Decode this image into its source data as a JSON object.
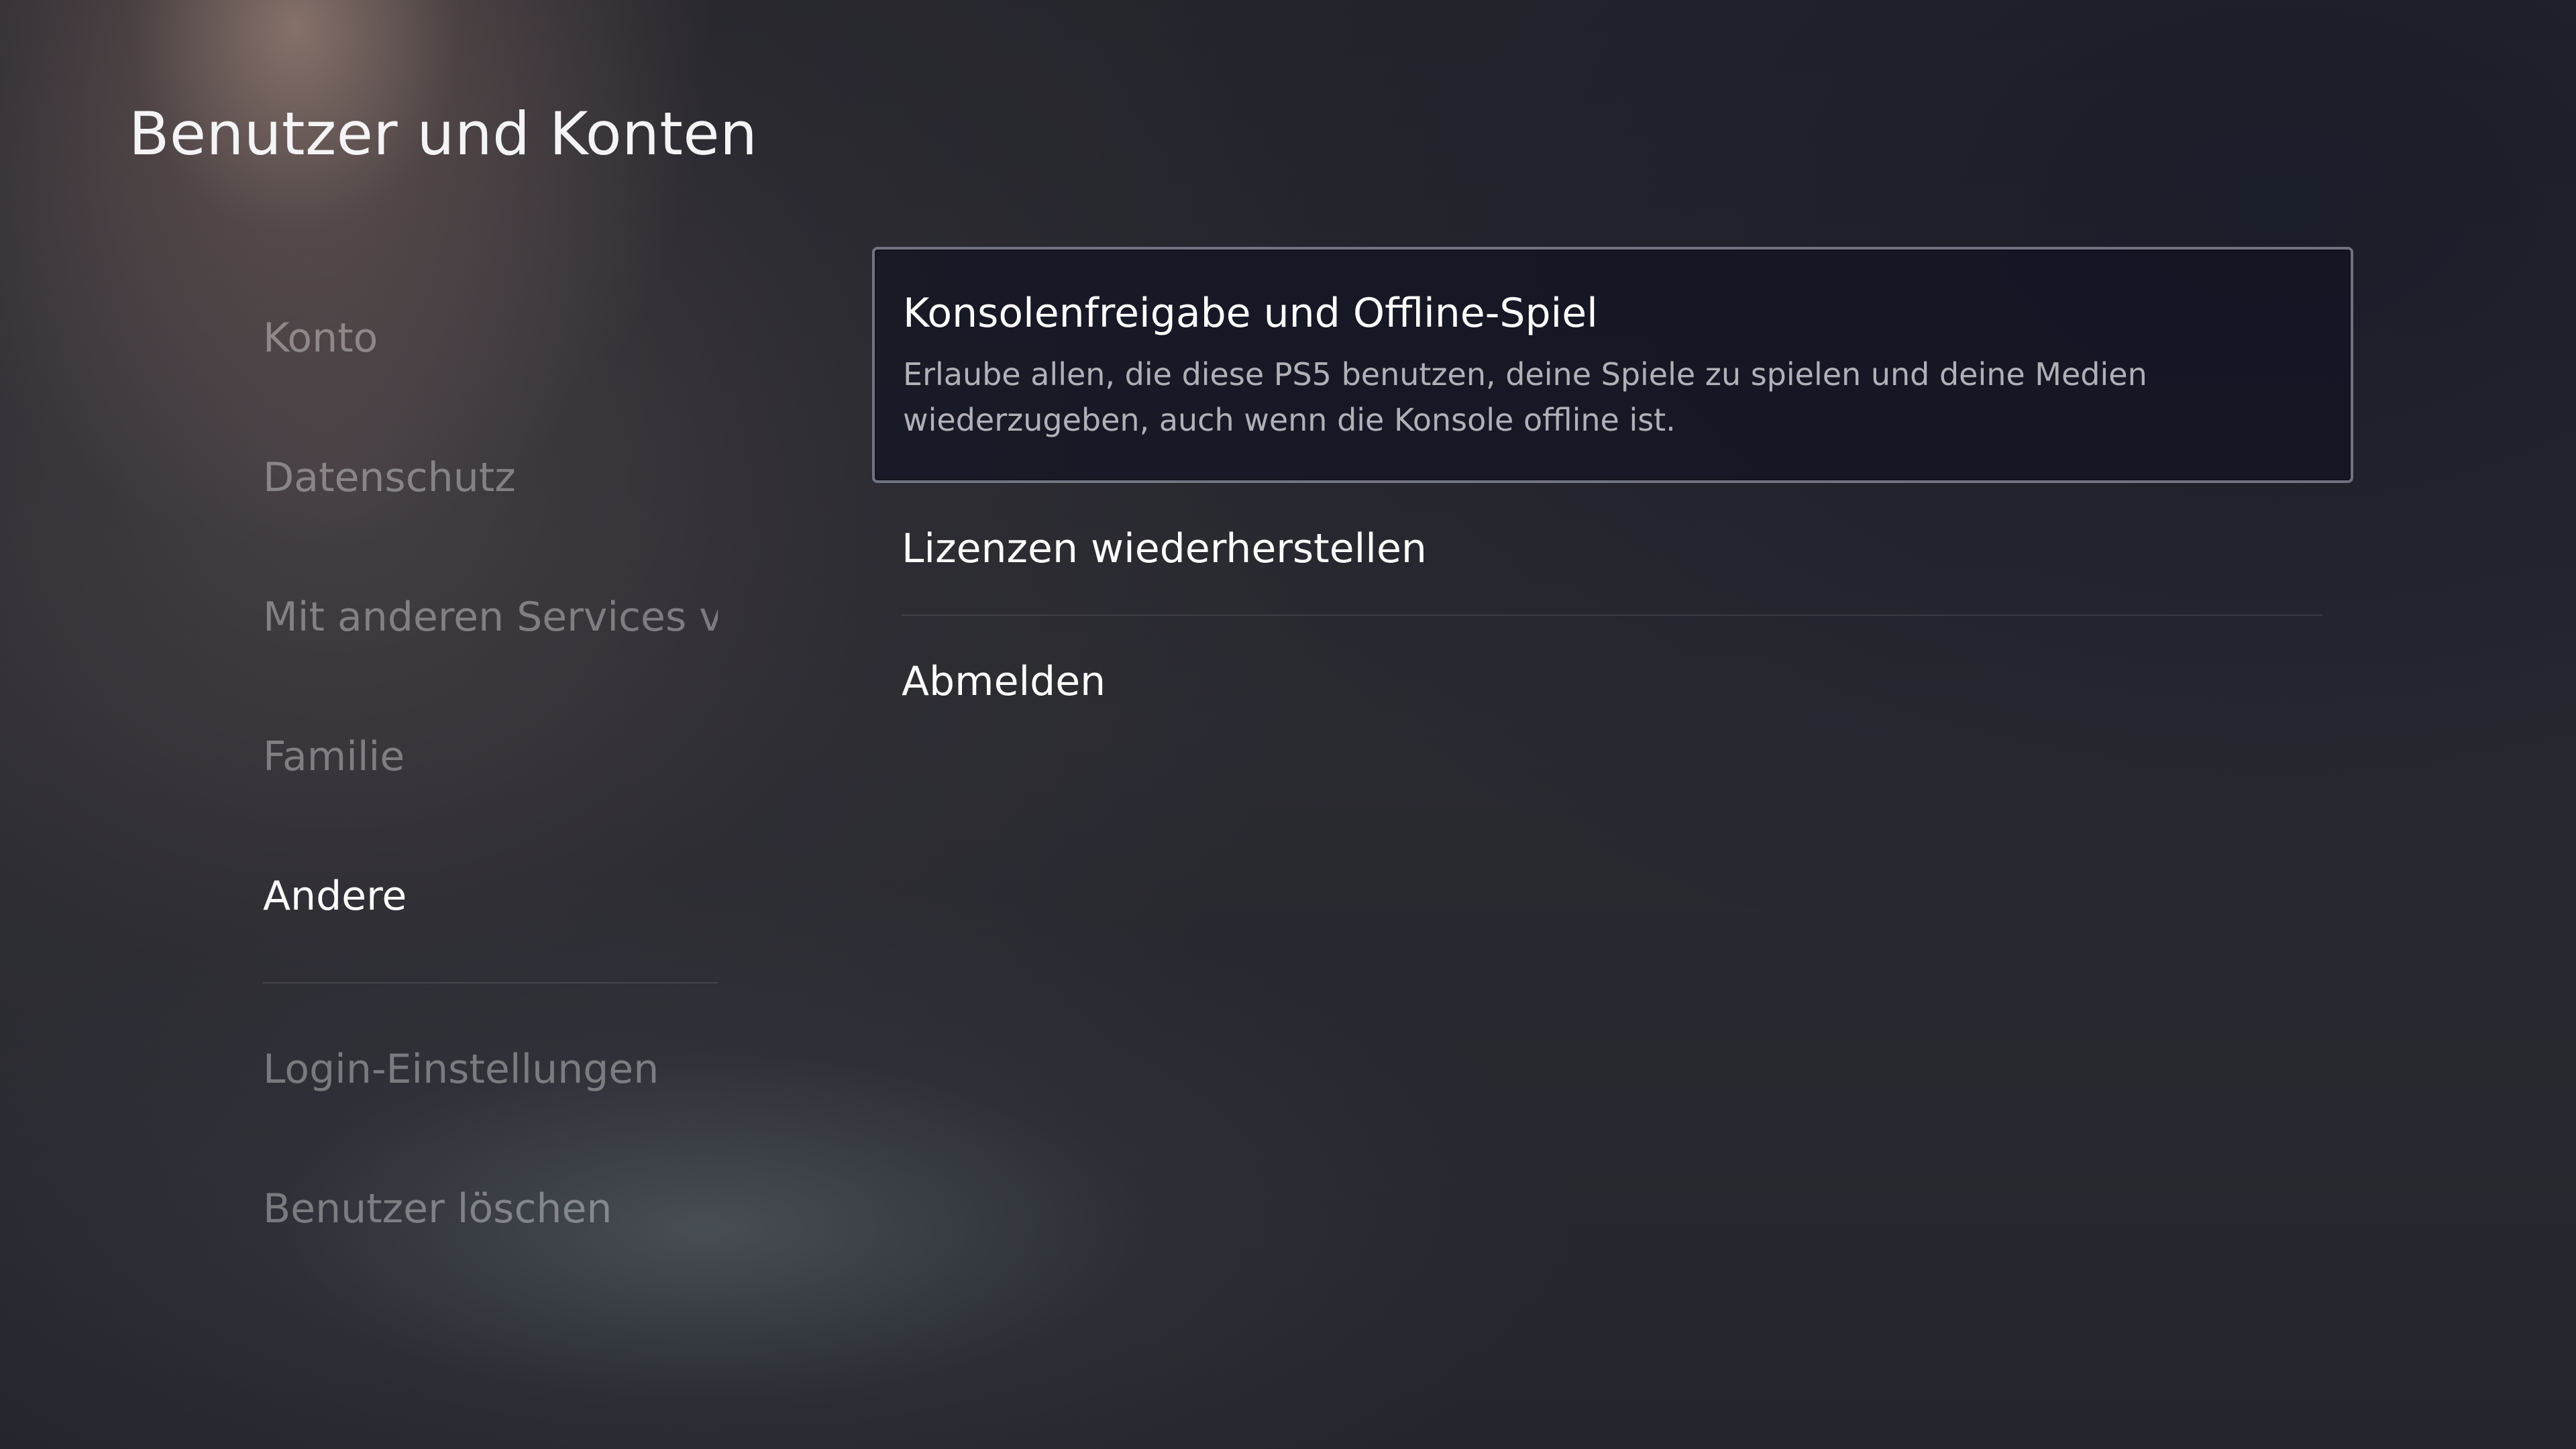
{
  "header": {
    "title": "Benutzer und Konten"
  },
  "sidebar": {
    "items": [
      {
        "label": "Konto"
      },
      {
        "label": "Datenschutz"
      },
      {
        "label": "Mit anderen Services v..."
      },
      {
        "label": "Familie"
      },
      {
        "label": "Andere",
        "selected": true
      }
    ],
    "secondary_items": [
      {
        "label": "Login-Einstellungen"
      },
      {
        "label": "Benutzer löschen"
      }
    ]
  },
  "main": {
    "options": [
      {
        "title": "Konsolenfreigabe und Offline-Spiel",
        "description": "Erlaube allen, die diese PS5 benutzen, deine Spiele zu spielen und deine Medien wiederzugeben, auch wenn die Konsole offline ist.",
        "focused": true
      },
      {
        "title": "Lizenzen wiederherstellen"
      },
      {
        "title": "Abmelden"
      }
    ]
  },
  "colors": {
    "text_primary": "#ffffff",
    "text_dimmed": "#5f5f66",
    "focus_border": "#bec0cd",
    "focus_background": "#121422"
  }
}
